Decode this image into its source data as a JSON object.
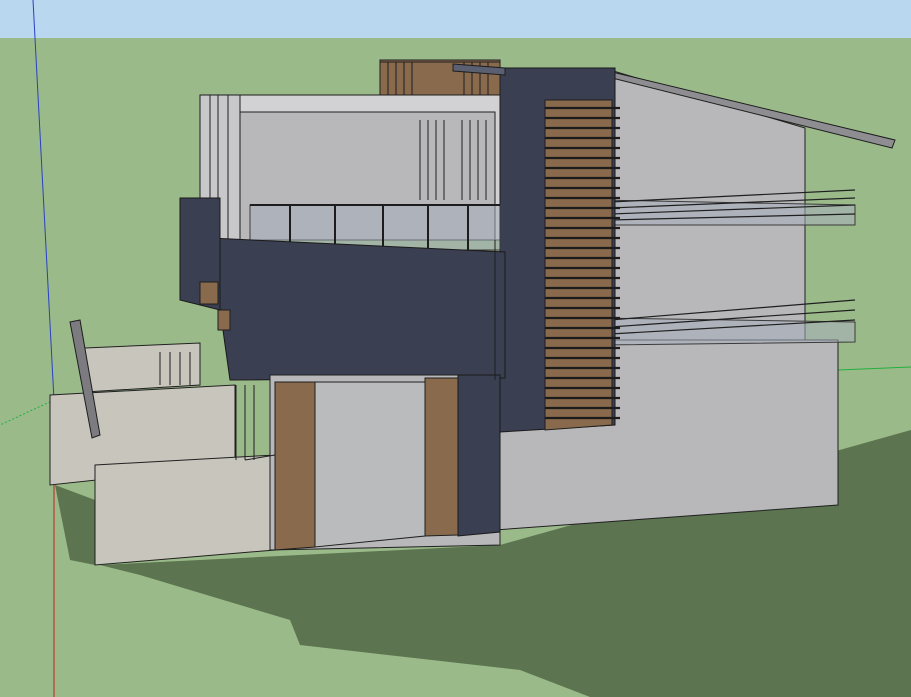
{
  "viewport": {
    "sky_color": "#b9d7ee",
    "ground_color": "#9bba8a",
    "shadow_color": "#5c7550",
    "axis_colors": {
      "blue": "#2a3fc4",
      "red": "#c02020",
      "green": "#20b040"
    }
  },
  "model": {
    "materials": {
      "wall_light": "#b8b8bb",
      "wall_warm": "#c7c5bc",
      "navy_cladding": "#3b3f52",
      "wood_panel": "#8a6a4c",
      "glass": "#a5afbc"
    }
  }
}
